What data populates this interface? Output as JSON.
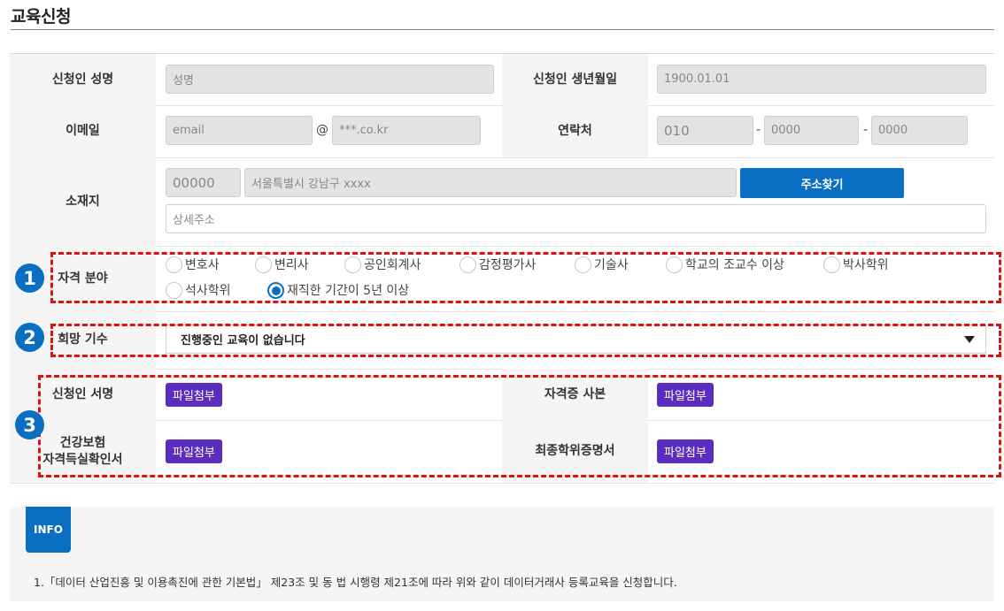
{
  "page": {
    "title": "교육신청"
  },
  "form": {
    "name": {
      "label": "신청인 성명",
      "placeholder": "성명"
    },
    "birth": {
      "label": "신청인 생년월일",
      "placeholder": "1900.01.01"
    },
    "email": {
      "label": "이메일",
      "local_placeholder": "email",
      "at": "@",
      "domain_placeholder": "***.co.kr"
    },
    "phone": {
      "label": "연락처",
      "part1": "010",
      "dash": "-",
      "part2_placeholder": "0000",
      "part3_placeholder": "0000"
    },
    "address": {
      "label": "소재지",
      "zip": "00000",
      "road": "서울특별시 강남구 xxxx",
      "search_button": "주소찾기",
      "detail_placeholder": "상세주소"
    },
    "qualification": {
      "label": "자격 분야",
      "options": [
        "변호사",
        "변리사",
        "공인회계사",
        "감정평가사",
        "기술사",
        "학교의 조교수 이상",
        "박사학위",
        "석사학위",
        "재직한 기간이 5년 이상"
      ],
      "selected": "재직한 기간이 5년 이상"
    },
    "cohort": {
      "label": "희망 기수",
      "selected_option": "진행중인 교육이 없습니다"
    },
    "attachments": {
      "signature_label": "신청인 서명",
      "license_label": "자격증 사본",
      "insurance_label_line1": "건강보험",
      "insurance_label_line2": "자격득실확인서",
      "degree_label": "최종학위증명서",
      "attach_button": "파일첨부"
    }
  },
  "callouts": [
    "1",
    "2",
    "3"
  ],
  "info": {
    "badge": "INFO",
    "text": "1.「데이터 산업진흥 및 이용촉진에 관한 기본법」 제23조 및 동 법 시행령 제21조에 따라 위와 같이 데이터거래사 등록교육을 신청합니다."
  },
  "colors": {
    "accent": "#0a6fc2",
    "file_button": "#5a2dbe",
    "highlight": "#e01010"
  }
}
